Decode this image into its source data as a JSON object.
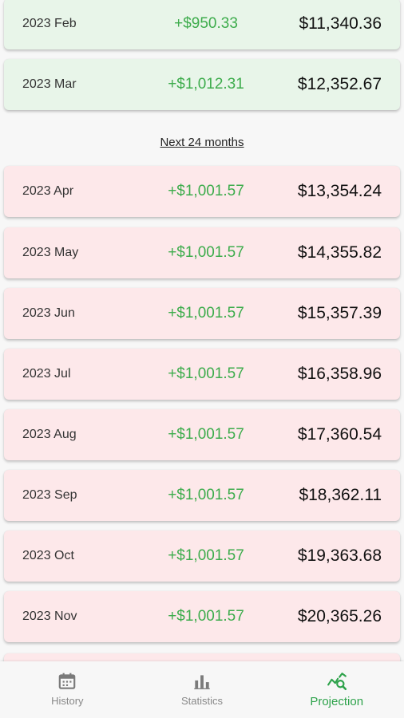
{
  "history_rows": [
    {
      "month": "2023 Feb",
      "change": "+$950.33",
      "balance": "$11,340.36"
    },
    {
      "month": "2023 Mar",
      "change": "+$1,012.31",
      "balance": "$12,352.67"
    }
  ],
  "projection_label": "Next 24 months",
  "projection_rows": [
    {
      "month": "2023 Apr",
      "change": "+$1,001.57",
      "balance": "$13,354.24"
    },
    {
      "month": "2023 May",
      "change": "+$1,001.57",
      "balance": "$14,355.82"
    },
    {
      "month": "2023 Jun",
      "change": "+$1,001.57",
      "balance": "$15,357.39"
    },
    {
      "month": "2023 Jul",
      "change": "+$1,001.57",
      "balance": "$16,358.96"
    },
    {
      "month": "2023 Aug",
      "change": "+$1,001.57",
      "balance": "$17,360.54"
    },
    {
      "month": "2023 Sep",
      "change": "+$1,001.57",
      "balance": "$18,362.11"
    },
    {
      "month": "2023 Oct",
      "change": "+$1,001.57",
      "balance": "$19,363.68"
    },
    {
      "month": "2023 Nov",
      "change": "+$1,001.57",
      "balance": "$20,365.26"
    }
  ],
  "nav": {
    "history": {
      "label": "History",
      "icon": "calendar-icon"
    },
    "statistics": {
      "label": "Statistics",
      "icon": "bar-chart-icon"
    },
    "projection": {
      "label": "Projection",
      "icon": "trend-search-icon",
      "active": true
    }
  },
  "colors": {
    "past_row_bg": "#e8f5e9",
    "projection_row_bg": "#fde8ea",
    "positive_change": "#3dac4c",
    "active_tab": "#2fa34c",
    "inactive_tab": "#888888"
  }
}
